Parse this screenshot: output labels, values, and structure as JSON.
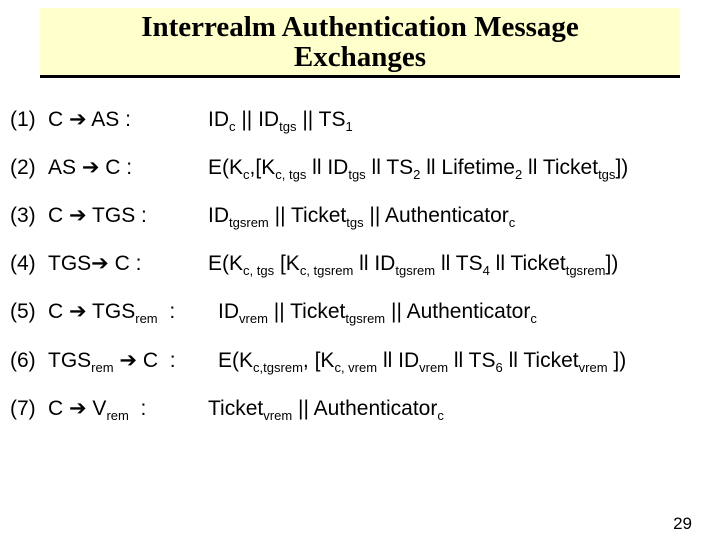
{
  "title_line1": "Interrealm Authentication Message",
  "title_line2": "Exchanges",
  "rows": [
    {
      "idx": "(1)",
      "dir_html": "C ➔ AS :",
      "msg_html": "ID<sub>c</sub> || ID<sub>tgs</sub> || TS<sub>1</sub>"
    },
    {
      "idx": "(2)",
      "dir_html": "AS ➔ C :",
      "msg_html": "E(K<sub>c</sub>,[K<sub>c, tgs</sub> ll ID<sub>tgs</sub> ll TS<sub>2</sub> ll Lifetime<sub>2</sub> ll Ticket<sub>tgs</sub>])"
    },
    {
      "idx": "(3)",
      "dir_html": "C ➔ TGS :",
      "msg_html": "ID<sub>tgsrem</sub> || Ticket<sub>tgs</sub> || Authenticator<sub>c</sub>"
    },
    {
      "idx": "(4)",
      "dir_html": "TGS➔ C :",
      "msg_html": "E(K<sub>c, tgs</sub> [K<sub>c, tgsrem</sub> ll ID<sub>tgsrem</sub> ll TS<sub>4</sub> ll Ticket<sub>tgsrem</sub>])"
    },
    {
      "idx": "(5)",
      "dir_html": "C ➔ TGS<sub>rem</sub>&nbsp; :",
      "msg_html": "ID<sub>vrem</sub> || Ticket<sub>tgsrem</sub> || Authenticator<sub>c</sub>"
    },
    {
      "idx": "(6)",
      "dir_html": "TGS<sub>rem</sub> ➔ C&nbsp; :",
      "msg_html": "E(K<sub>c,tgsrem</sub>, [K<sub>c, vrem</sub> ll ID<sub>vrem</sub> ll TS<sub>6</sub> ll Ticket<sub>vrem</sub> ])"
    },
    {
      "idx": "(7)",
      "dir_html": "C ➔ V<sub>rem</sub>&nbsp; :",
      "msg_html": "Ticket<sub>vrem</sub> || Authenticator<sub>c</sub>"
    }
  ],
  "page_number": "29"
}
